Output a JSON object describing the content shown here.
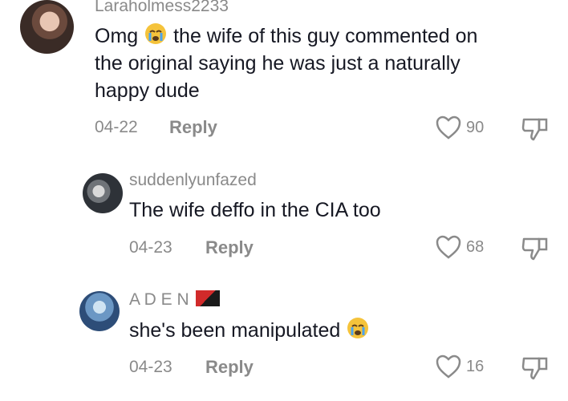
{
  "comments": [
    {
      "username": "Laraholmess2233",
      "text_before_emoji": "Omg",
      "text_after_emoji": "the wife of this guy commented on",
      "text_line2": "the original saying he was just a naturally",
      "text_line3": "happy dude",
      "date": "04-22",
      "reply_label": "Reply",
      "likes": "90"
    },
    {
      "username": "suddenlyunfazed",
      "text": "The wife deffo in the CIA too",
      "date": "04-23",
      "reply_label": "Reply",
      "likes": "68"
    },
    {
      "username": "A D E N",
      "text": "she's been manipulated",
      "date": "04-23",
      "reply_label": "Reply",
      "likes": "16"
    }
  ],
  "icons": {
    "emoji": "loudly-crying-face-icon",
    "like": "heart-outline-icon",
    "dislike": "thumbs-down-icon",
    "flag": "papua-new-guinea-flag-icon"
  },
  "colors": {
    "text": "#161823",
    "muted": "#8a8a8a",
    "emoji": "#f5c33b"
  }
}
